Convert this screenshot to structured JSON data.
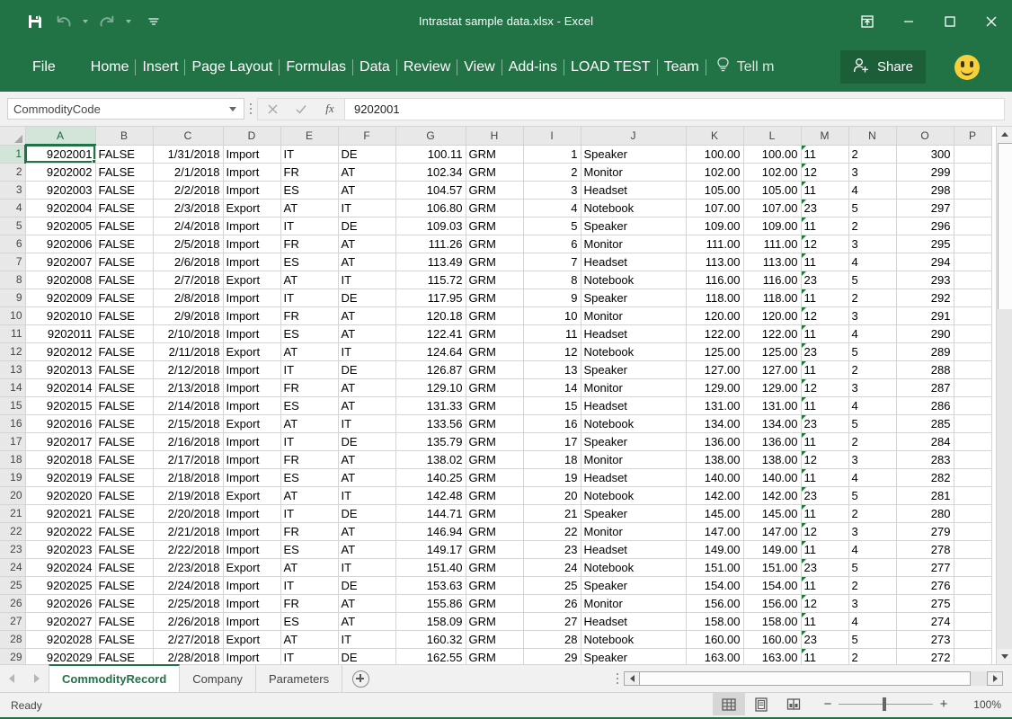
{
  "window": {
    "title": "Intrastat sample data.xlsx - Excel",
    "controls": {
      "ribbon_display_options": "ribbon-display-options",
      "minimize": "minimize",
      "maximize": "maximize",
      "close": "close"
    }
  },
  "quick_access": {
    "save": "Save",
    "undo": "Undo",
    "redo": "Redo",
    "customize": "Customize Quick Access Toolbar"
  },
  "ribbon": {
    "file_label": "File",
    "tabs": [
      "Home",
      "Insert",
      "Page Layout",
      "Formulas",
      "Data",
      "Review",
      "View",
      "Add-ins",
      "LOAD TEST",
      "Team"
    ],
    "tell_me": "Tell m",
    "share_label": "Share"
  },
  "formula_bar": {
    "name_box_value": "CommodityCode",
    "cancel": "Cancel",
    "enter": "Enter",
    "insert_function": "fx",
    "formula_value": "9202001",
    "placeholder": ""
  },
  "grid": {
    "columns": [
      "A",
      "B",
      "C",
      "D",
      "E",
      "F",
      "G",
      "H",
      "I",
      "J",
      "K",
      "L",
      "M",
      "N",
      "O",
      "P"
    ],
    "selected_column": "A",
    "selected_row": "1",
    "selected_cell": "A1",
    "rows": [
      {
        "n": "1",
        "A": "9202001",
        "B": "FALSE",
        "C": "1/31/2018",
        "D": "Import",
        "E": "IT",
        "F": "DE",
        "G": "100.11",
        "H": "GRM",
        "I": "1",
        "J": "Speaker",
        "K": "100.00",
        "L": "100.00",
        "M": "11",
        "N": "2",
        "O": "300",
        "P": ""
      },
      {
        "n": "2",
        "A": "9202002",
        "B": "FALSE",
        "C": "2/1/2018",
        "D": "Import",
        "E": "FR",
        "F": "AT",
        "G": "102.34",
        "H": "GRM",
        "I": "2",
        "J": "Monitor",
        "K": "102.00",
        "L": "102.00",
        "M": "12",
        "N": "3",
        "O": "299",
        "P": ""
      },
      {
        "n": "3",
        "A": "9202003",
        "B": "FALSE",
        "C": "2/2/2018",
        "D": "Import",
        "E": "ES",
        "F": "AT",
        "G": "104.57",
        "H": "GRM",
        "I": "3",
        "J": "Headset",
        "K": "105.00",
        "L": "105.00",
        "M": "11",
        "N": "4",
        "O": "298",
        "P": ""
      },
      {
        "n": "4",
        "A": "9202004",
        "B": "FALSE",
        "C": "2/3/2018",
        "D": "Export",
        "E": "AT",
        "F": "IT",
        "G": "106.80",
        "H": "GRM",
        "I": "4",
        "J": "Notebook",
        "K": "107.00",
        "L": "107.00",
        "M": "23",
        "N": "5",
        "O": "297",
        "P": ""
      },
      {
        "n": "5",
        "A": "9202005",
        "B": "FALSE",
        "C": "2/4/2018",
        "D": "Import",
        "E": "IT",
        "F": "DE",
        "G": "109.03",
        "H": "GRM",
        "I": "5",
        "J": "Speaker",
        "K": "109.00",
        "L": "109.00",
        "M": "11",
        "N": "2",
        "O": "296",
        "P": ""
      },
      {
        "n": "6",
        "A": "9202006",
        "B": "FALSE",
        "C": "2/5/2018",
        "D": "Import",
        "E": "FR",
        "F": "AT",
        "G": "111.26",
        "H": "GRM",
        "I": "6",
        "J": "Monitor",
        "K": "111.00",
        "L": "111.00",
        "M": "12",
        "N": "3",
        "O": "295",
        "P": ""
      },
      {
        "n": "7",
        "A": "9202007",
        "B": "FALSE",
        "C": "2/6/2018",
        "D": "Import",
        "E": "ES",
        "F": "AT",
        "G": "113.49",
        "H": "GRM",
        "I": "7",
        "J": "Headset",
        "K": "113.00",
        "L": "113.00",
        "M": "11",
        "N": "4",
        "O": "294",
        "P": ""
      },
      {
        "n": "8",
        "A": "9202008",
        "B": "FALSE",
        "C": "2/7/2018",
        "D": "Export",
        "E": "AT",
        "F": "IT",
        "G": "115.72",
        "H": "GRM",
        "I": "8",
        "J": "Notebook",
        "K": "116.00",
        "L": "116.00",
        "M": "23",
        "N": "5",
        "O": "293",
        "P": ""
      },
      {
        "n": "9",
        "A": "9202009",
        "B": "FALSE",
        "C": "2/8/2018",
        "D": "Import",
        "E": "IT",
        "F": "DE",
        "G": "117.95",
        "H": "GRM",
        "I": "9",
        "J": "Speaker",
        "K": "118.00",
        "L": "118.00",
        "M": "11",
        "N": "2",
        "O": "292",
        "P": ""
      },
      {
        "n": "10",
        "A": "9202010",
        "B": "FALSE",
        "C": "2/9/2018",
        "D": "Import",
        "E": "FR",
        "F": "AT",
        "G": "120.18",
        "H": "GRM",
        "I": "10",
        "J": "Monitor",
        "K": "120.00",
        "L": "120.00",
        "M": "12",
        "N": "3",
        "O": "291",
        "P": ""
      },
      {
        "n": "11",
        "A": "9202011",
        "B": "FALSE",
        "C": "2/10/2018",
        "D": "Import",
        "E": "ES",
        "F": "AT",
        "G": "122.41",
        "H": "GRM",
        "I": "11",
        "J": "Headset",
        "K": "122.00",
        "L": "122.00",
        "M": "11",
        "N": "4",
        "O": "290",
        "P": ""
      },
      {
        "n": "12",
        "A": "9202012",
        "B": "FALSE",
        "C": "2/11/2018",
        "D": "Export",
        "E": "AT",
        "F": "IT",
        "G": "124.64",
        "H": "GRM",
        "I": "12",
        "J": "Notebook",
        "K": "125.00",
        "L": "125.00",
        "M": "23",
        "N": "5",
        "O": "289",
        "P": ""
      },
      {
        "n": "13",
        "A": "9202013",
        "B": "FALSE",
        "C": "2/12/2018",
        "D": "Import",
        "E": "IT",
        "F": "DE",
        "G": "126.87",
        "H": "GRM",
        "I": "13",
        "J": "Speaker",
        "K": "127.00",
        "L": "127.00",
        "M": "11",
        "N": "2",
        "O": "288",
        "P": ""
      },
      {
        "n": "14",
        "A": "9202014",
        "B": "FALSE",
        "C": "2/13/2018",
        "D": "Import",
        "E": "FR",
        "F": "AT",
        "G": "129.10",
        "H": "GRM",
        "I": "14",
        "J": "Monitor",
        "K": "129.00",
        "L": "129.00",
        "M": "12",
        "N": "3",
        "O": "287",
        "P": ""
      },
      {
        "n": "15",
        "A": "9202015",
        "B": "FALSE",
        "C": "2/14/2018",
        "D": "Import",
        "E": "ES",
        "F": "AT",
        "G": "131.33",
        "H": "GRM",
        "I": "15",
        "J": "Headset",
        "K": "131.00",
        "L": "131.00",
        "M": "11",
        "N": "4",
        "O": "286",
        "P": ""
      },
      {
        "n": "16",
        "A": "9202016",
        "B": "FALSE",
        "C": "2/15/2018",
        "D": "Export",
        "E": "AT",
        "F": "IT",
        "G": "133.56",
        "H": "GRM",
        "I": "16",
        "J": "Notebook",
        "K": "134.00",
        "L": "134.00",
        "M": "23",
        "N": "5",
        "O": "285",
        "P": ""
      },
      {
        "n": "17",
        "A": "9202017",
        "B": "FALSE",
        "C": "2/16/2018",
        "D": "Import",
        "E": "IT",
        "F": "DE",
        "G": "135.79",
        "H": "GRM",
        "I": "17",
        "J": "Speaker",
        "K": "136.00",
        "L": "136.00",
        "M": "11",
        "N": "2",
        "O": "284",
        "P": ""
      },
      {
        "n": "18",
        "A": "9202018",
        "B": "FALSE",
        "C": "2/17/2018",
        "D": "Import",
        "E": "FR",
        "F": "AT",
        "G": "138.02",
        "H": "GRM",
        "I": "18",
        "J": "Monitor",
        "K": "138.00",
        "L": "138.00",
        "M": "12",
        "N": "3",
        "O": "283",
        "P": ""
      },
      {
        "n": "19",
        "A": "9202019",
        "B": "FALSE",
        "C": "2/18/2018",
        "D": "Import",
        "E": "ES",
        "F": "AT",
        "G": "140.25",
        "H": "GRM",
        "I": "19",
        "J": "Headset",
        "K": "140.00",
        "L": "140.00",
        "M": "11",
        "N": "4",
        "O": "282",
        "P": ""
      },
      {
        "n": "20",
        "A": "9202020",
        "B": "FALSE",
        "C": "2/19/2018",
        "D": "Export",
        "E": "AT",
        "F": "IT",
        "G": "142.48",
        "H": "GRM",
        "I": "20",
        "J": "Notebook",
        "K": "142.00",
        "L": "142.00",
        "M": "23",
        "N": "5",
        "O": "281",
        "P": ""
      },
      {
        "n": "21",
        "A": "9202021",
        "B": "FALSE",
        "C": "2/20/2018",
        "D": "Import",
        "E": "IT",
        "F": "DE",
        "G": "144.71",
        "H": "GRM",
        "I": "21",
        "J": "Speaker",
        "K": "145.00",
        "L": "145.00",
        "M": "11",
        "N": "2",
        "O": "280",
        "P": ""
      },
      {
        "n": "22",
        "A": "9202022",
        "B": "FALSE",
        "C": "2/21/2018",
        "D": "Import",
        "E": "FR",
        "F": "AT",
        "G": "146.94",
        "H": "GRM",
        "I": "22",
        "J": "Monitor",
        "K": "147.00",
        "L": "147.00",
        "M": "12",
        "N": "3",
        "O": "279",
        "P": ""
      },
      {
        "n": "23",
        "A": "9202023",
        "B": "FALSE",
        "C": "2/22/2018",
        "D": "Import",
        "E": "ES",
        "F": "AT",
        "G": "149.17",
        "H": "GRM",
        "I": "23",
        "J": "Headset",
        "K": "149.00",
        "L": "149.00",
        "M": "11",
        "N": "4",
        "O": "278",
        "P": ""
      },
      {
        "n": "24",
        "A": "9202024",
        "B": "FALSE",
        "C": "2/23/2018",
        "D": "Export",
        "E": "AT",
        "F": "IT",
        "G": "151.40",
        "H": "GRM",
        "I": "24",
        "J": "Notebook",
        "K": "151.00",
        "L": "151.00",
        "M": "23",
        "N": "5",
        "O": "277",
        "P": ""
      },
      {
        "n": "25",
        "A": "9202025",
        "B": "FALSE",
        "C": "2/24/2018",
        "D": "Import",
        "E": "IT",
        "F": "DE",
        "G": "153.63",
        "H": "GRM",
        "I": "25",
        "J": "Speaker",
        "K": "154.00",
        "L": "154.00",
        "M": "11",
        "N": "2",
        "O": "276",
        "P": ""
      },
      {
        "n": "26",
        "A": "9202026",
        "B": "FALSE",
        "C": "2/25/2018",
        "D": "Import",
        "E": "FR",
        "F": "AT",
        "G": "155.86",
        "H": "GRM",
        "I": "26",
        "J": "Monitor",
        "K": "156.00",
        "L": "156.00",
        "M": "12",
        "N": "3",
        "O": "275",
        "P": ""
      },
      {
        "n": "27",
        "A": "9202027",
        "B": "FALSE",
        "C": "2/26/2018",
        "D": "Import",
        "E": "ES",
        "F": "AT",
        "G": "158.09",
        "H": "GRM",
        "I": "27",
        "J": "Headset",
        "K": "158.00",
        "L": "158.00",
        "M": "11",
        "N": "4",
        "O": "274",
        "P": ""
      },
      {
        "n": "28",
        "A": "9202028",
        "B": "FALSE",
        "C": "2/27/2018",
        "D": "Export",
        "E": "AT",
        "F": "IT",
        "G": "160.32",
        "H": "GRM",
        "I": "28",
        "J": "Notebook",
        "K": "160.00",
        "L": "160.00",
        "M": "23",
        "N": "5",
        "O": "273",
        "P": ""
      },
      {
        "n": "29",
        "A": "9202029",
        "B": "FALSE",
        "C": "2/28/2018",
        "D": "Import",
        "E": "IT",
        "F": "DE",
        "G": "162.55",
        "H": "GRM",
        "I": "29",
        "J": "Speaker",
        "K": "163.00",
        "L": "163.00",
        "M": "11",
        "N": "2",
        "O": "272",
        "P": ""
      }
    ]
  },
  "sheet_tabs": {
    "tabs": [
      "CommodityRecord",
      "Company",
      "Parameters"
    ],
    "active": "CommodityRecord",
    "add_label": "New sheet"
  },
  "status_bar": {
    "message": "Ready",
    "views": [
      "Normal",
      "Page Layout",
      "Page Break Preview"
    ],
    "active_view": "Normal",
    "zoom_out": "−",
    "zoom_in": "+",
    "zoom_level": "100%"
  },
  "colors": {
    "accent": "#217346",
    "accent_dark": "#1b5e38",
    "header_bg": "#e8e8e8",
    "error_triangle": "#1a7a34"
  }
}
